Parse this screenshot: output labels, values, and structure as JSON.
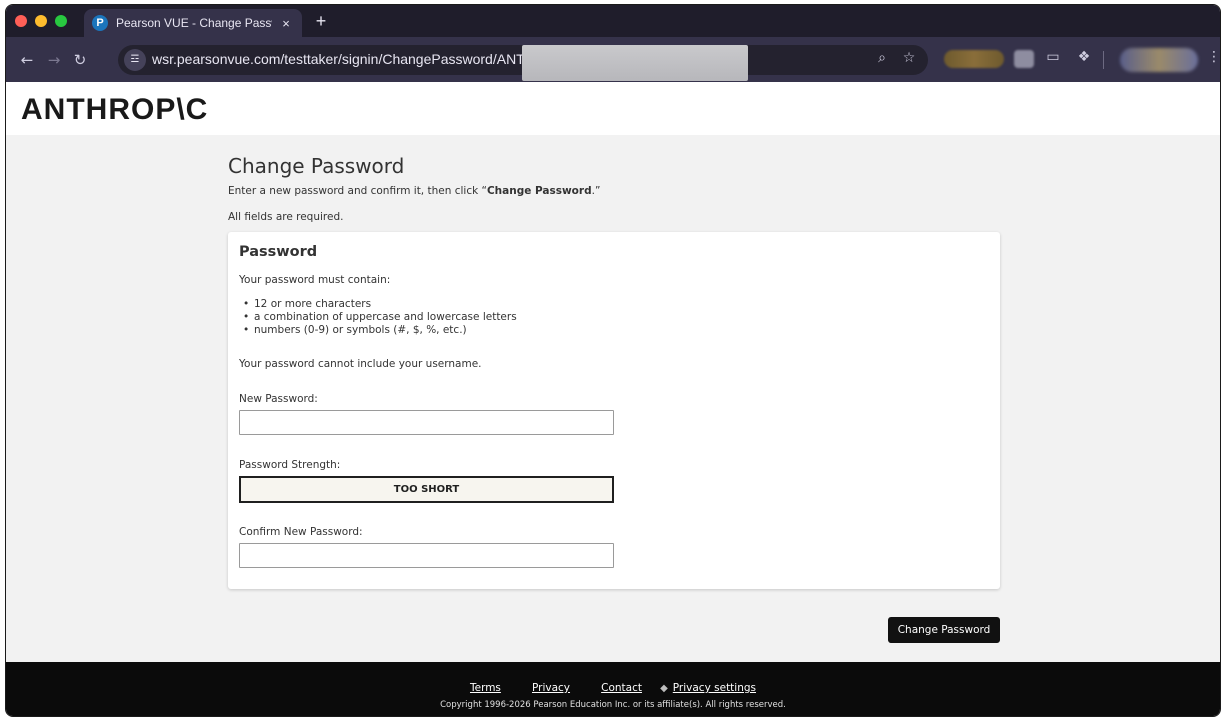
{
  "browser": {
    "tab_title": "Pearson VUE - Change Passw",
    "tab_favicon": "P",
    "tab_close": "×",
    "new_tab": "+",
    "url": "wsr.pearsonvue.com/testtaker/signin/ChangePassword/ANTH"
  },
  "icons": {
    "back": "←",
    "forward": "→",
    "reload": "↻",
    "site_info": "☲",
    "zoom": "⌕",
    "star": "☆",
    "cast": "▭",
    "puzzle": "❖",
    "menu": "⋮",
    "cookie": "◆"
  },
  "header": {
    "logo": "ANTHROP\\C"
  },
  "page": {
    "title": "Change Password",
    "instructions_prefix": "Enter a new password and confirm it, then click “",
    "instructions_bold": "Change Password",
    "instructions_suffix": ".”",
    "required_note": "All fields are required."
  },
  "card": {
    "title": "Password",
    "must_contain": "Your password must contain:",
    "rules": [
      "12 or more characters",
      "a combination of uppercase and lowercase letters",
      "numbers (0-9) or symbols (#, $, %, etc.)"
    ],
    "no_username": "Your password cannot include your username.",
    "new_password_label": "New Password:",
    "new_password_value": "",
    "strength_label": "Password Strength:",
    "strength_value": "TOO SHORT",
    "confirm_label": "Confirm New Password:",
    "confirm_value": ""
  },
  "actions": {
    "submit_label": "Change Password"
  },
  "footer": {
    "links": {
      "terms": "Terms",
      "privacy": "Privacy",
      "contact": "Contact",
      "privacy_settings": "Privacy settings"
    },
    "copyright": "Copyright 1996-2026 Pearson Education Inc. or its affiliate(s). All rights reserved."
  }
}
